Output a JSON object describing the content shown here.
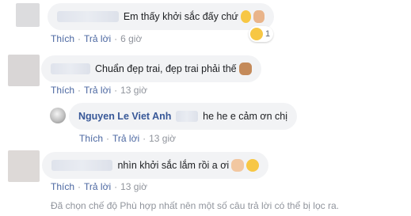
{
  "comments": [
    {
      "text": "Em thấy khởi sắc đấy chứ",
      "emojis": [
        "smiling-face-icon",
        "ok-hand-icon"
      ],
      "reaction": {
        "icon": "laughing-face-icon",
        "count": "1"
      },
      "actions": {
        "like": "Thích",
        "reply": "Trả lời",
        "time": "6 giờ"
      }
    },
    {
      "text": "Chuẩn đẹp trai, đẹp trai phải thế",
      "emojis": [
        "thumbs-up-icon"
      ],
      "actions": {
        "like": "Thích",
        "reply": "Trả lời",
        "time": "13 giờ"
      }
    },
    {
      "author": "Nguyen Le Viet Anh",
      "text": "he he e cảm ơn chị",
      "actions": {
        "like": "Thích",
        "reply": "Trả lời",
        "time": "13 giờ"
      }
    },
    {
      "text": "nhìn khởi sắc lắm rồi a ơi",
      "emojis": [
        "clapping-hands-icon",
        "hugging-face-icon"
      ],
      "actions": {
        "like": "Thích",
        "reply": "Trả lời",
        "time": "13 giờ"
      }
    }
  ],
  "footer_note": "Đã chọn chế độ Phù hợp nhất nên một số câu trả lời có thể bị lọc ra.",
  "colors": {
    "bubble": "#f2f3f5",
    "link": "#4b67a1",
    "author": "#385898",
    "meta": "#90949c"
  }
}
